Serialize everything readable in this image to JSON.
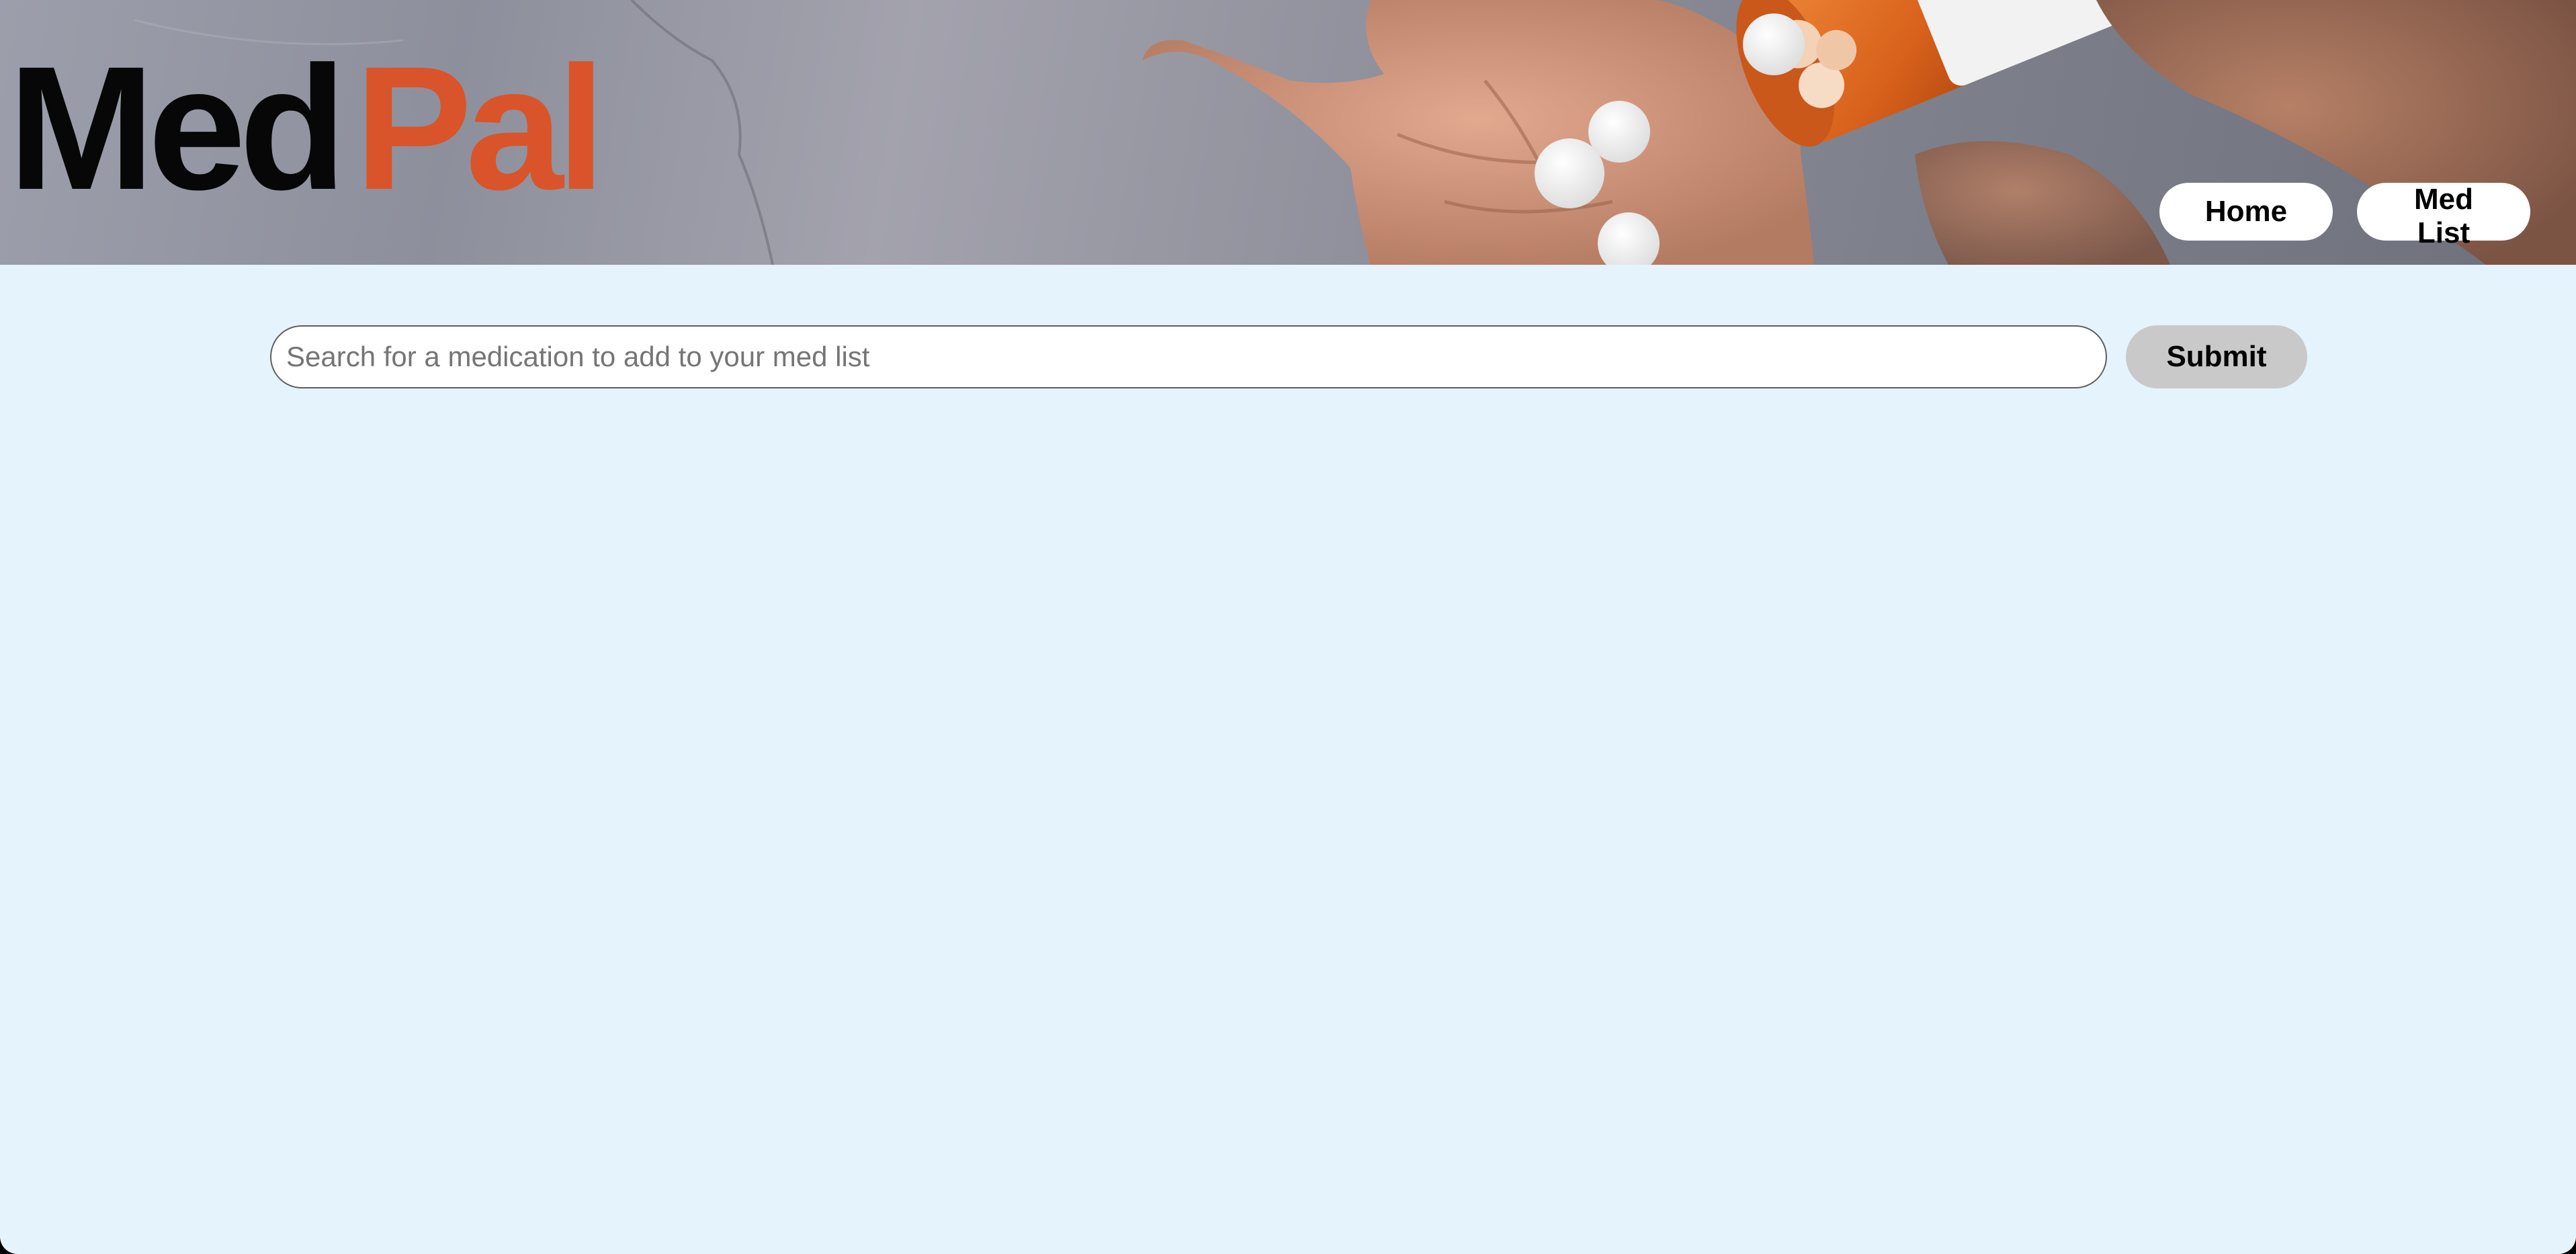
{
  "header": {
    "logo": {
      "part1": "Med",
      "part2": "Pal"
    },
    "nav": {
      "home_label": "Home",
      "medlist_label": "Med List"
    },
    "hero_image": "hands-with-pill-bottle-photo"
  },
  "search": {
    "placeholder": "Search for a medication to add to your med list",
    "value": "",
    "submit_label": "Submit"
  },
  "colors": {
    "page_background": "#e5f3fc",
    "brand_dark": "#070707",
    "brand_accent": "#d9542a",
    "submit_background": "#c9c9c9",
    "nav_button_background": "#ffffff"
  }
}
